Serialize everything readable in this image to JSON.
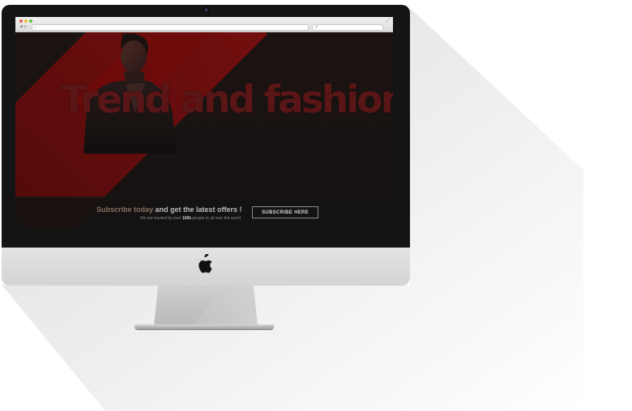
{
  "browser": {
    "traffic_lights": [
      "close",
      "minimize",
      "maximize"
    ],
    "icons": {
      "back": "back-arrow-icon",
      "forward": "forward-arrow-icon",
      "home": "home-icon",
      "search": "search-icon",
      "expand": "expand-icon"
    }
  },
  "hero": {
    "title": "Trend and fashion"
  },
  "subscribe": {
    "headline_highlight": "Subscribe today",
    "headline_rest": " and get the latest offers !",
    "trust_prefix": "We are trusted by over ",
    "trust_count": "100k",
    "trust_suffix": " people in all over the world",
    "button_label": "SUBSCRIBE HERE"
  },
  "colors": {
    "accent_red": "#7a1010",
    "headline_highlight": "#8a6f62",
    "screen_bg": "#161212",
    "bezel": "#141414",
    "chin": "#d8d8d8"
  },
  "device": {
    "logo": "apple-logo"
  }
}
